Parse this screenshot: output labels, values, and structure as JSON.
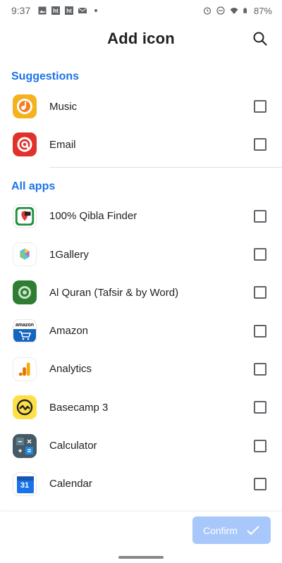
{
  "status_bar": {
    "time": "9:37",
    "battery": "87%"
  },
  "header": {
    "title": "Add icon"
  },
  "sections": {
    "suggestions": {
      "title": "Suggestions",
      "items": [
        {
          "label": "Music"
        },
        {
          "label": "Email"
        }
      ]
    },
    "all_apps": {
      "title": "All apps",
      "items": [
        {
          "label": "100% Qibla Finder"
        },
        {
          "label": "1Gallery"
        },
        {
          "label": "Al Quran (Tafsir & by Word)"
        },
        {
          "label": "Amazon"
        },
        {
          "label": "Analytics"
        },
        {
          "label": "Basecamp 3"
        },
        {
          "label": "Calculator"
        },
        {
          "label": "Calendar"
        }
      ]
    }
  },
  "calendar_icon_text": "31",
  "amazon_icon_text": "amazon",
  "footer": {
    "confirm_label": "Confirm"
  },
  "colors": {
    "accent": "#1a73e8",
    "confirm_disabled": "#a8c7fa"
  }
}
